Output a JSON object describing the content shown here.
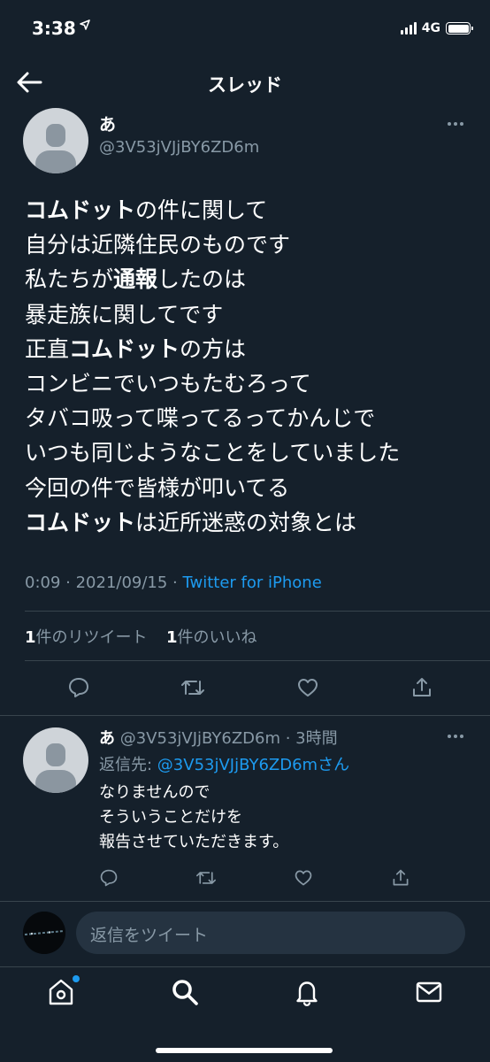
{
  "status_bar": {
    "time": "3:38",
    "network": "4G"
  },
  "header": {
    "title": "スレッド"
  },
  "main_tweet": {
    "name": "あ",
    "handle": "@3V53jVJjBY6ZD6m",
    "lines": [
      [
        {
          "t": "コムドット",
          "b": true
        },
        {
          "t": "の件に関して"
        }
      ],
      [
        {
          "t": "自分は近隣住民のものです"
        }
      ],
      [
        {
          "t": "私たちが"
        },
        {
          "t": "通報",
          "b": true
        },
        {
          "t": "したのは"
        }
      ],
      [
        {
          "t": "暴走族に関してです"
        }
      ],
      [
        {
          "t": "正直"
        },
        {
          "t": "コムドット",
          "b": true
        },
        {
          "t": "の方は"
        }
      ],
      [
        {
          "t": "コンビニでいつもたむろって"
        }
      ],
      [
        {
          "t": "タバコ吸って喋ってるってかんじで"
        }
      ],
      [
        {
          "t": "いつも同じようなことをしていました"
        }
      ],
      [
        {
          "t": "今回の件で皆様が叩いてる"
        }
      ],
      [
        {
          "t": "コムドット",
          "b": true
        },
        {
          "t": "は近所迷惑の対象とは"
        }
      ]
    ],
    "time": "0:09 · 2021/09/15 · ",
    "source": "Twitter for iPhone",
    "retweet_count": "1",
    "retweet_label": "件のリツイート",
    "like_count": "1",
    "like_label": "件のいいね"
  },
  "reply": {
    "name": "あ",
    "handle_time": " @3V53jVJjBY6ZD6m · 3時間",
    "reply_prefix": "返信先: ",
    "reply_handle": "@3V53jVJjBY6ZD6mさん",
    "lines": [
      "なりませんので",
      "そういうことだけを",
      "報告させていただきます。"
    ]
  },
  "composer": {
    "placeholder": "返信をツイート"
  },
  "icons": {
    "back": "arrow-left-icon",
    "reply": "reply-icon",
    "retweet": "retweet-icon",
    "like": "heart-icon",
    "share": "share-icon",
    "home": "home-icon",
    "search": "search-icon",
    "notifications": "bell-icon",
    "messages": "mail-icon"
  },
  "colors": {
    "background": "#15202b",
    "accent": "#1d9bf0",
    "muted": "#8899a6",
    "divider": "#38444d"
  }
}
